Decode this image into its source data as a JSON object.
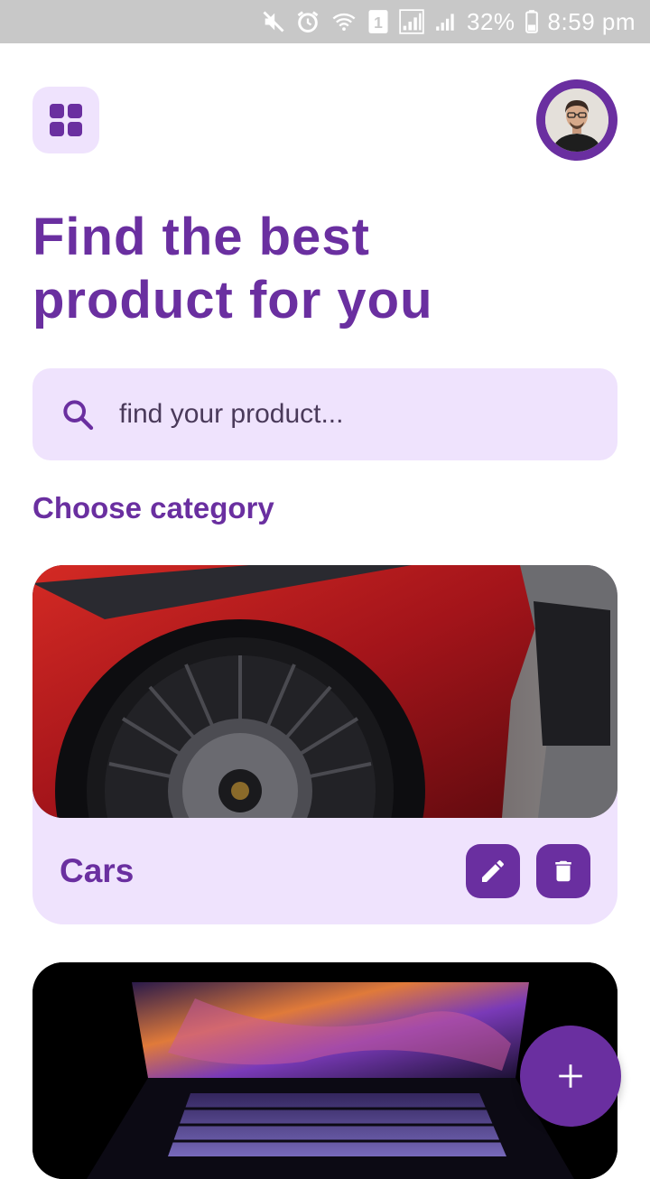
{
  "status_bar": {
    "battery": "32%",
    "time": "8:59 pm",
    "sim_badge": "1",
    "icons": [
      "mute-icon",
      "alarm-icon",
      "wifi-icon",
      "sim-icon",
      "signal-icon",
      "signal-icon",
      "battery-icon"
    ]
  },
  "header": {
    "menu_icon": "grid-icon",
    "avatar_icon": "profile-photo"
  },
  "title": {
    "line1": "Find the best",
    "line2": "product for you"
  },
  "search": {
    "placeholder": "find your product...",
    "icon": "search-icon"
  },
  "section": {
    "title": "Choose category"
  },
  "categories": [
    {
      "label": "Cars",
      "image": "car-wheel-photo",
      "actions": [
        "edit-icon",
        "delete-icon"
      ]
    },
    {
      "label": "",
      "image": "laptop-photo"
    }
  ],
  "fab": {
    "icon": "plus-icon"
  },
  "colors": {
    "accent": "#6a2fa0",
    "accent_light": "#efe3fd",
    "status_bar": "#c8c8c8"
  }
}
